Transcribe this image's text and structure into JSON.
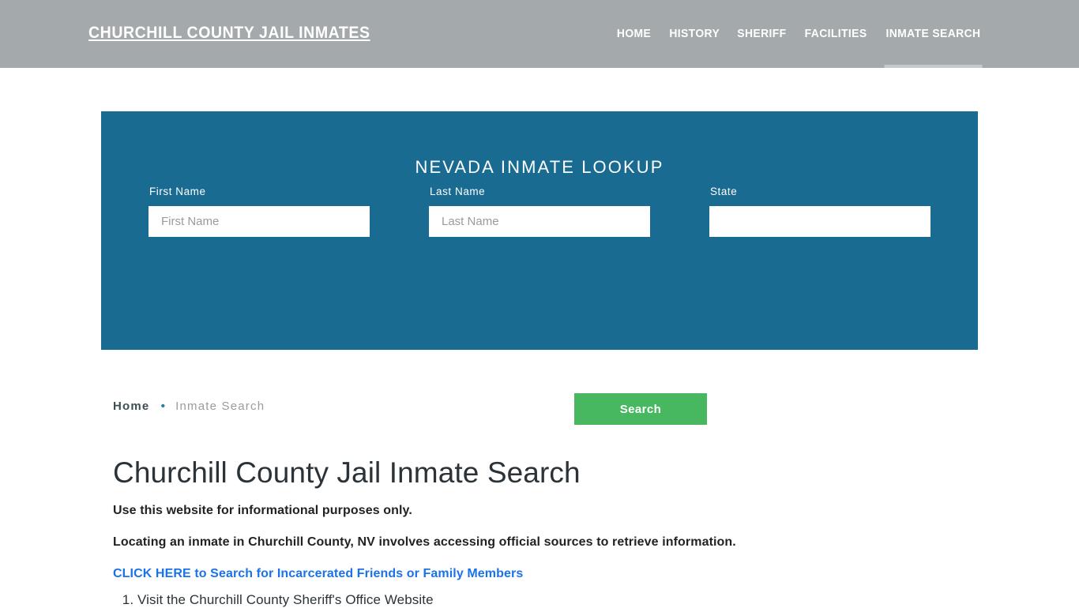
{
  "header": {
    "brand": "CHURCHILL COUNTY JAIL INMATES",
    "background_color": "#a4a9ac",
    "nav": [
      {
        "label": "HOME",
        "active": false
      },
      {
        "label": "HISTORY",
        "active": false
      },
      {
        "label": "SHERIFF",
        "active": false
      },
      {
        "label": "FACILITIES",
        "active": false
      },
      {
        "label": "INMATE SEARCH",
        "active": true
      }
    ]
  },
  "lookup": {
    "title": "NEVADA INMATE LOOKUP",
    "panel_color": "#1a6b91",
    "fields": {
      "first_name": {
        "label": "First Name",
        "placeholder": "First Name",
        "value": ""
      },
      "last_name": {
        "label": "Last Name",
        "placeholder": "Last Name",
        "value": ""
      },
      "state": {
        "label": "State",
        "placeholder": "",
        "value": ""
      }
    },
    "submit_label": "Search",
    "submit_color": "#47b860"
  },
  "breadcrumb": {
    "home_label": "Home",
    "separator": "•",
    "current_label": "Inmate Search"
  },
  "main": {
    "title": "Churchill County Jail Inmate Search",
    "paragraph_1": "Use this website for informational purposes only.",
    "paragraph_2": "Locating an inmate in Churchill County, NV involves accessing official sources to retrieve information.",
    "cta_link": "CLICK HERE to Search for Incarcerated Friends or Family Members",
    "cta_color": "#1a73e8",
    "steps": [
      "Visit the Churchill County Sheriff's Office Website"
    ]
  }
}
